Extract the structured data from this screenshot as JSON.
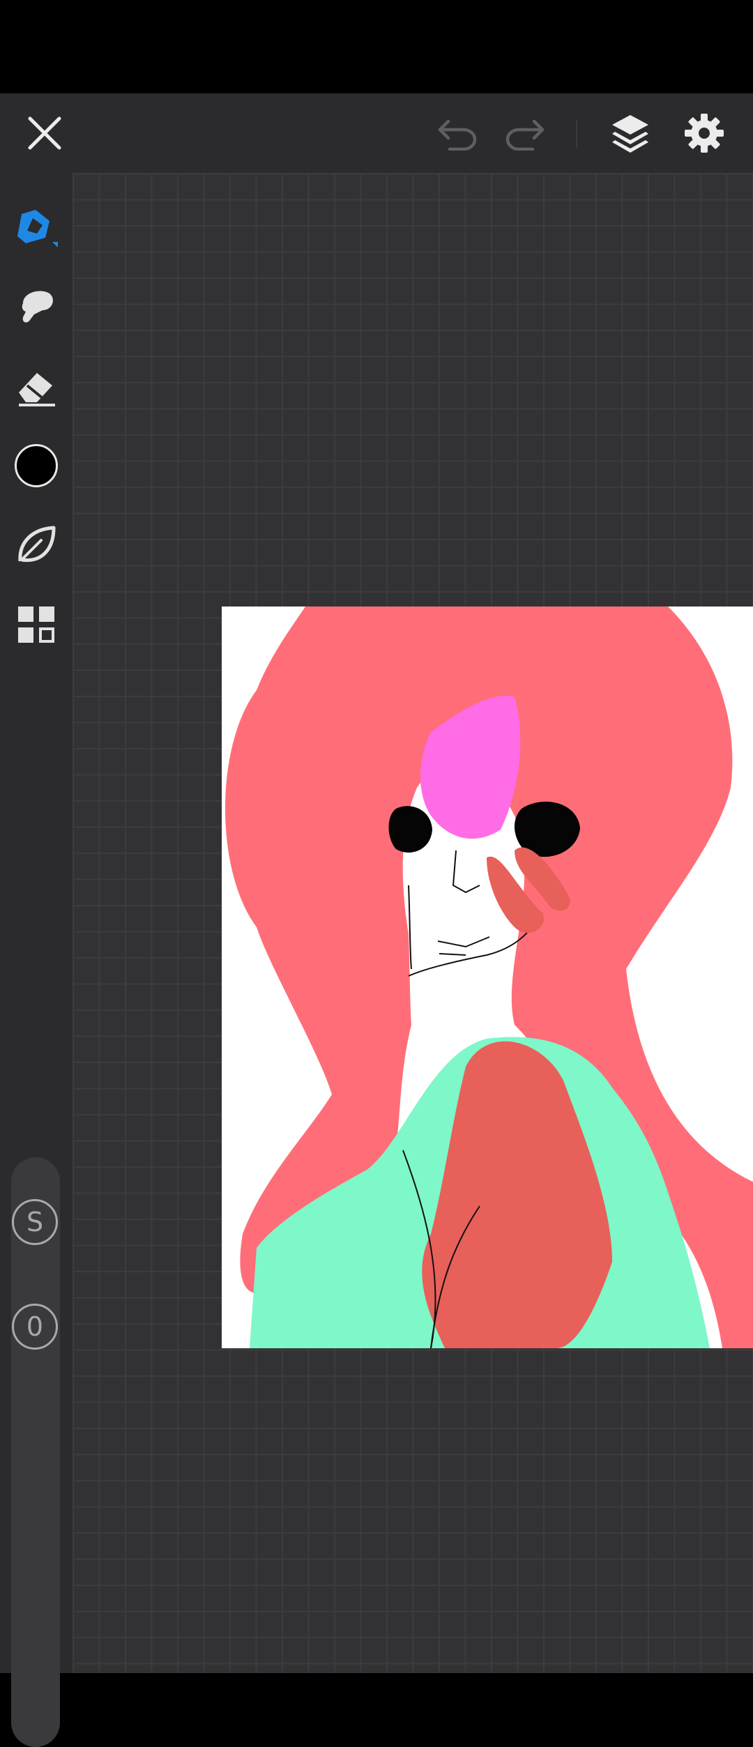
{
  "app": {
    "toolbar": {
      "close": {
        "icon": "close-icon"
      },
      "undo": {
        "icon": "undo-icon",
        "enabled": false
      },
      "redo": {
        "icon": "redo-icon",
        "enabled": false
      },
      "layers": {
        "icon": "layers-icon"
      },
      "settings": {
        "icon": "gear-icon"
      }
    },
    "tools": [
      {
        "id": "pen",
        "icon": "pen-tool-icon",
        "active": true
      },
      {
        "id": "smudge",
        "icon": "smudge-icon",
        "active": false
      },
      {
        "id": "eraser",
        "icon": "eraser-icon",
        "active": false
      },
      {
        "id": "color",
        "icon": "color-swatch",
        "active": false
      },
      {
        "id": "brush-library",
        "icon": "leaf-icon",
        "active": false
      },
      {
        "id": "gallery",
        "icon": "grid-icon",
        "active": false
      }
    ],
    "slider": {
      "size_label": "S",
      "opacity_label": "0"
    },
    "colors": {
      "accent": "#1e88e5",
      "current_color": "#000000",
      "toolbar_bg": "#2b2b2d",
      "workspace_bg": "#323235",
      "grid_line": "#3c3c40"
    }
  }
}
